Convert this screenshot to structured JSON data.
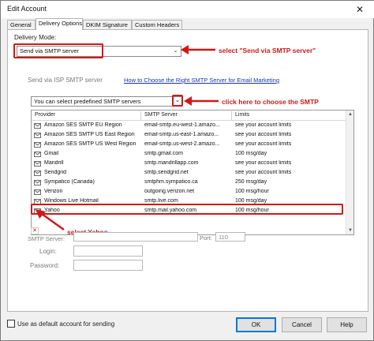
{
  "window": {
    "title": "Edit Account",
    "close_glyph": "✕"
  },
  "tabs": [
    {
      "label": "General",
      "active": false
    },
    {
      "label": "Delivery Options",
      "active": true
    },
    {
      "label": "DKIM Signature",
      "active": false
    },
    {
      "label": "Custom Headers",
      "active": false
    }
  ],
  "delivery": {
    "mode_label": "Delivery Mode:",
    "mode_value": "Send via SMTP server"
  },
  "smtp_section": {
    "heading": "Send via ISP SMTP server",
    "help_link": "How to Choose the Right SMTP Server for Email Marketing",
    "predefined_select": "You can select predefined SMTP servers"
  },
  "annotations": {
    "select_mode": "select \"Send via SMTP server\"",
    "choose_smtp": "click here to choose the SMTP",
    "select_yahoo": "select Yahoo",
    "color": "#d21818"
  },
  "provider_table": {
    "columns": [
      "Provider",
      "SMTP Server",
      "Limits"
    ],
    "rows": [
      [
        "Amazon SES SMTP EU Region",
        "email-smtp.eu-west-1.amazo...",
        "see your account limits"
      ],
      [
        "Amazon SES SMTP US East Region",
        "email-smtp.us-east-1.amazo...",
        "see your account limits"
      ],
      [
        "Amazon SES SMTP US West Region",
        "email-smtp.us-west-2.amazo...",
        "see your account limits"
      ],
      [
        "Gmail",
        "smtp.gmail.com",
        "100 msg/day"
      ],
      [
        "Mandrill",
        "smtp.mandrillapp.com",
        "see your account limits"
      ],
      [
        "Sendgrid",
        "smtp.sendgrid.net",
        "see your account limits"
      ],
      [
        "Sympatico (Canada)",
        "smtphm.sympatico.ca",
        "250 msg/day"
      ],
      [
        "Verizon",
        "outgoing.verizon.net",
        "100 msg/hour"
      ],
      [
        "Windows Live Hotmail",
        "smtp.live.com",
        "100 msg/day"
      ],
      [
        "Yahoo",
        "smtp.mail.yahoo.com",
        "100 msg/hour"
      ]
    ],
    "highlighted_provider": "Yahoo"
  },
  "form": {
    "server_label": "SMTP Server:",
    "port_label": "Port:",
    "port_value": "110",
    "login_label": "Login:",
    "password_label": "Password:"
  },
  "footer": {
    "default_checkbox": "Use as default account for sending",
    "ok": "OK",
    "cancel": "Cancel",
    "help": "Help"
  }
}
